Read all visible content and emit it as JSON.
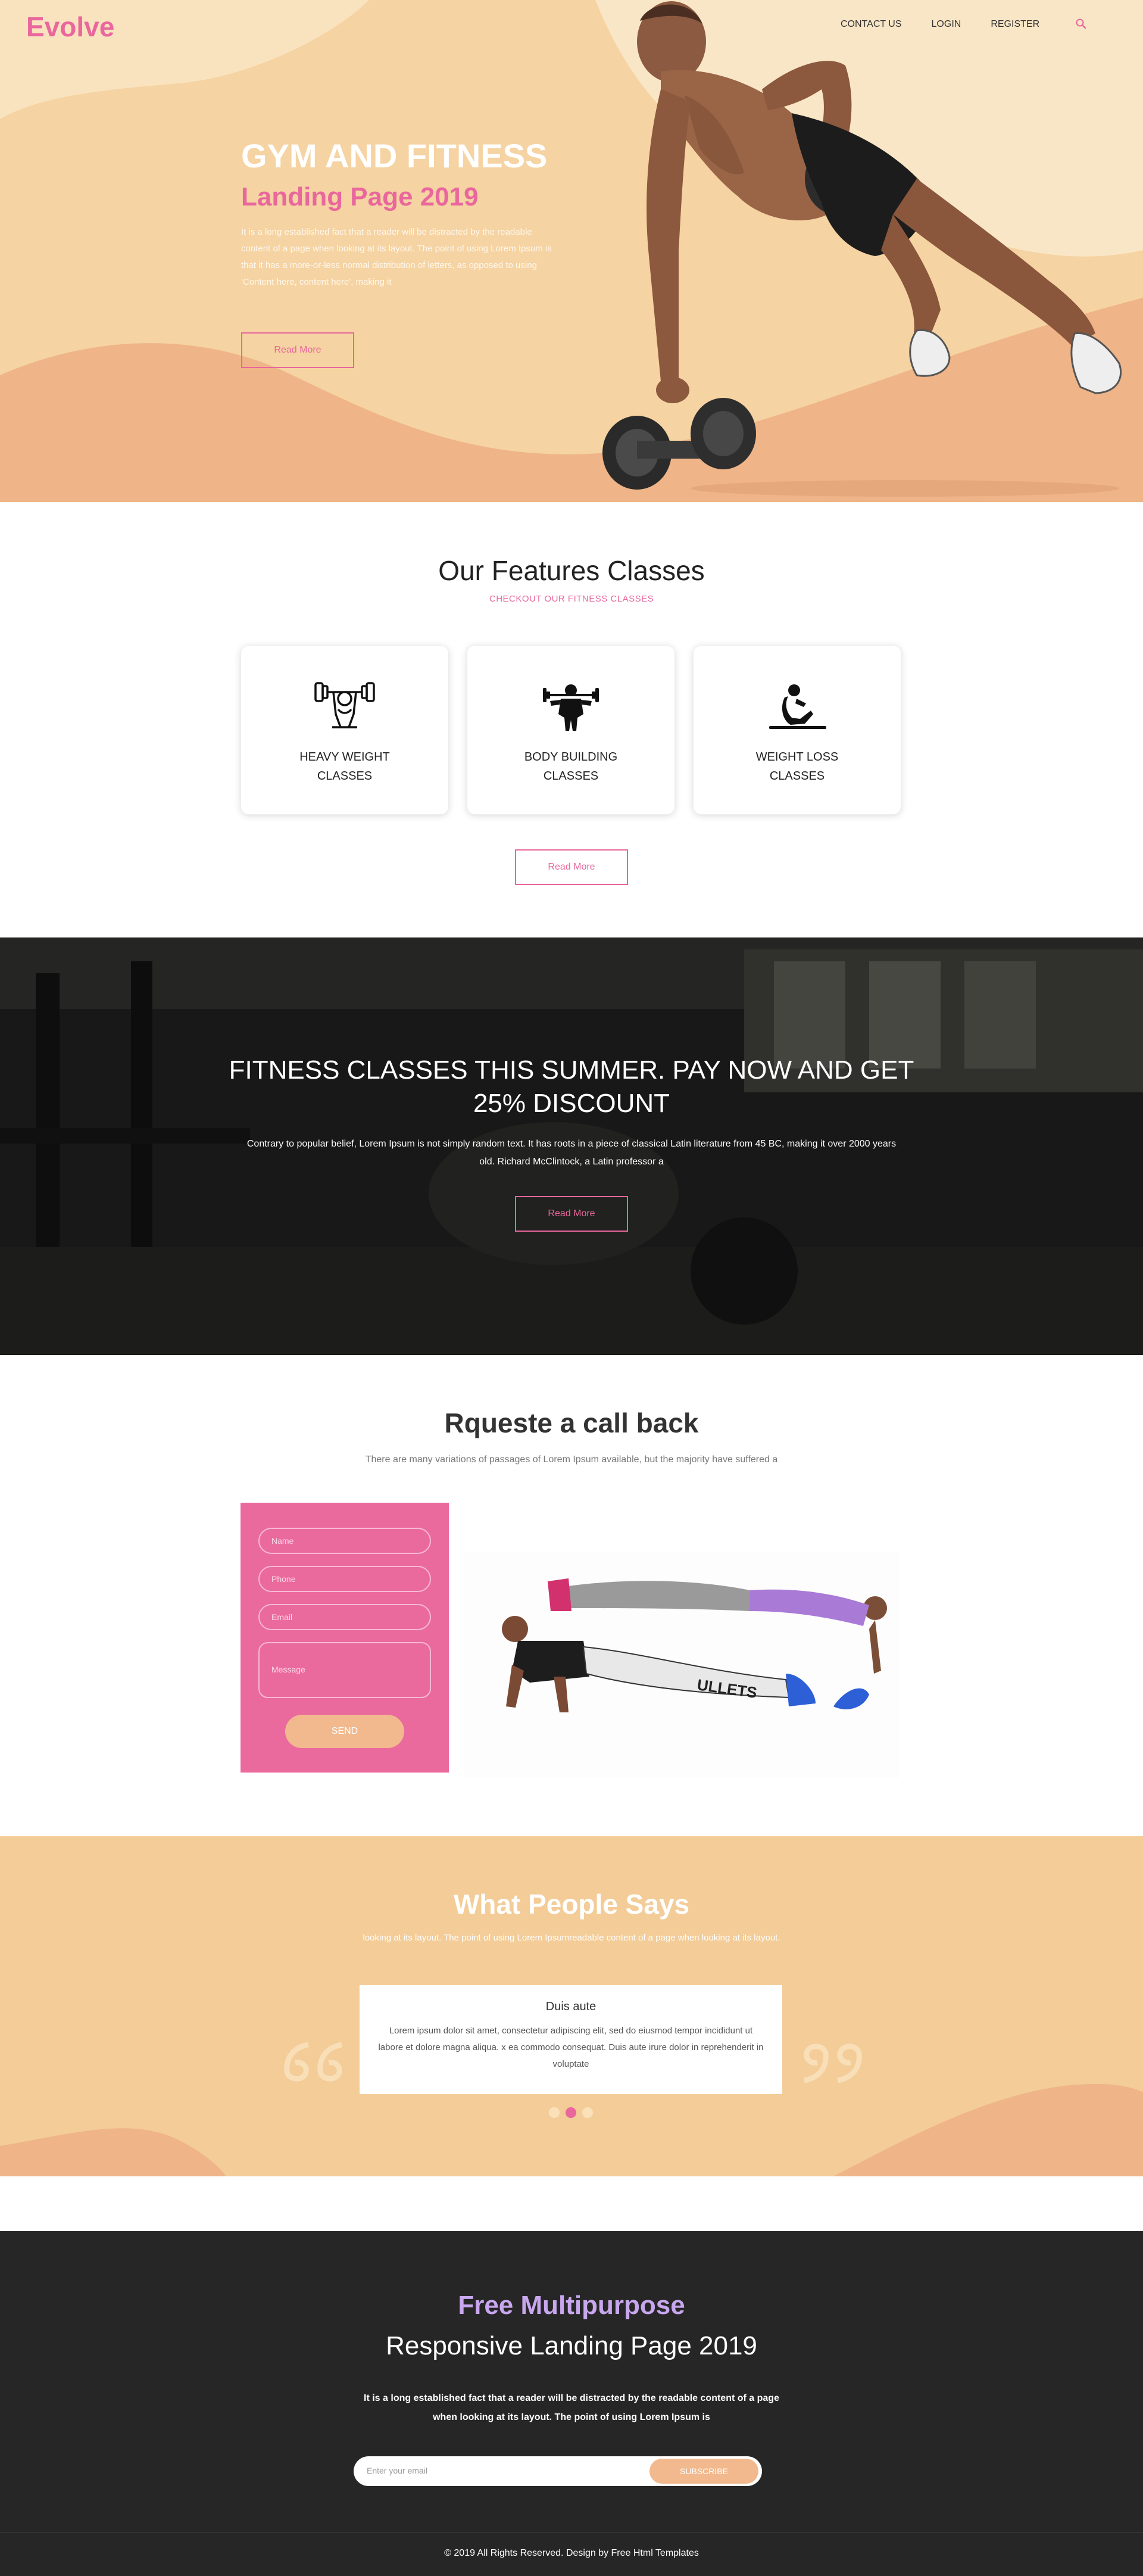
{
  "brand": {
    "logo": "Evolve",
    "accent": "#e9679c",
    "peach": "#f1b98d",
    "sand": "#f6d6a6"
  },
  "nav": {
    "links": [
      "CONTACT US",
      "LOGIN",
      "REGISTER"
    ],
    "search_icon": "search-icon"
  },
  "hero": {
    "title": "GYM AND FITNESS",
    "subtitle": "Landing Page 2019",
    "description": "It is a long established fact that a reader will be distracted by the readable content of a page when looking at its layout. The point of using Lorem Ipsum is that it has a more-or-less normal distribution of letters, as opposed to using 'Content here, content here', making it",
    "button": "Read More"
  },
  "features": {
    "title": "Our Features Classes",
    "kicker": "CHECKOUT OUR FITNESS CLASSES",
    "cards": [
      {
        "icon": "weightlifter-icon",
        "label": "HEAVY WEIGHT CLASSES"
      },
      {
        "icon": "bodybuilder-icon",
        "label": "BODY BUILDING CLASSES"
      },
      {
        "icon": "situp-icon",
        "label": "WEIGHT LOSS CLASSES"
      }
    ],
    "button": "Read More"
  },
  "promo": {
    "title": "FITNESS CLASSES THIS SUMMER. PAY NOW AND GET 25% DISCOUNT",
    "description": "Contrary to popular belief, Lorem Ipsum is not simply random text. It has roots in a piece of classical Latin literature from 45 BC, making it over 2000 years old. Richard McClintock, a Latin professor a",
    "button": "Read More"
  },
  "callback": {
    "title": "Rqueste a call back",
    "description": "There are many variations of passages of Lorem Ipsum available, but the majority have suffered a",
    "form": {
      "name_placeholder": "Name",
      "phone_placeholder": "Phone",
      "email_placeholder": "Email",
      "message_placeholder": "Message",
      "send": "SEND"
    }
  },
  "testimonials": {
    "title": "What People Says",
    "description": "looking at its layout. The point of using Lorem Ipsumreadable content of a page when looking at its layout.",
    "card": {
      "name": "Duis aute",
      "text": "Lorem ipsum dolor sit amet, consectetur adipiscing elit, sed do eiusmod tempor incididunt ut labore et dolore magna aliqua. x ea commodo consequat. Duis aute irure dolor in reprehenderit in voluptate"
    },
    "dots": 3,
    "active_dot": 2
  },
  "footer": {
    "title1": "Free Multipurpose",
    "title2": "Responsive Landing Page 2019",
    "description": "It is a long established fact that a reader will be distracted by the readable content of a page when looking at its layout. The point of using Lorem Ipsum is",
    "email_placeholder": "Enter your email",
    "subscribe": "SUBSCRIBE",
    "copyright": "© 2019 All Rights Reserved. Design by Free Html Templates"
  }
}
